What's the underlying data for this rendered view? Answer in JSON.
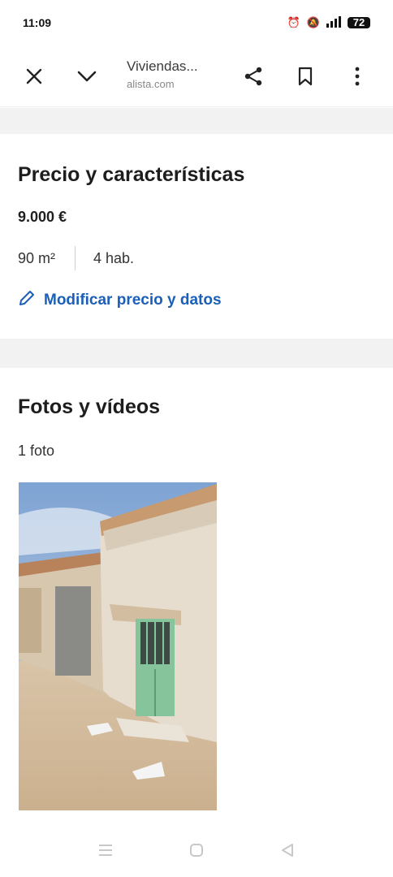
{
  "status_bar": {
    "time": "11:09",
    "battery": "72"
  },
  "browser": {
    "title": "Viviendas...",
    "url": "alista.com",
    "icons": [
      "close-icon",
      "chevron-down-icon",
      "share-icon",
      "bookmark-icon",
      "more-vert-icon"
    ]
  },
  "price_section": {
    "heading": "Precio y características",
    "price": "9.000 €",
    "area": "90 m²",
    "rooms": "4 hab.",
    "edit_label": "Modificar precio y datos"
  },
  "photos_section": {
    "heading": "Fotos y vídeos",
    "count": "1 foto"
  },
  "colors": {
    "accent": "#1b5fb8",
    "page_bg": "#f1f2f1",
    "door_green": "#86c59c"
  }
}
